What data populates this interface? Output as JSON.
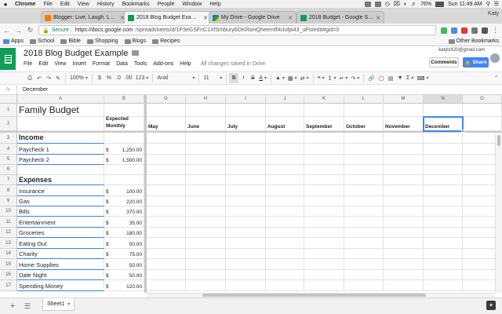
{
  "os_menubar": {
    "app": "Chrome",
    "items": [
      "File",
      "Edit",
      "View",
      "History",
      "Bookmarks",
      "People",
      "Window",
      "Help"
    ],
    "battery": "76%",
    "clock": "Sun 11:49 AM",
    "user": "Katy"
  },
  "browser_tabs": [
    {
      "title": "Blogger: Live. Laugh. Lowe.",
      "color": "#ff7a00"
    },
    {
      "title": "2018 Blog Budget Example - G",
      "color": "#0f9d58",
      "active": true
    },
    {
      "title": "My Drive - Google Drive",
      "color": "#1a73e8"
    },
    {
      "title": "2018 Budget - Google Sheets",
      "color": "#0f9d58"
    }
  ],
  "address_bar": {
    "secure_label": "Secure",
    "url_host": "https://docs.google.com",
    "url_path": "/spreadsheets/d/1P3eGSFnC1XfSmbury6OKRoHQheemff4clufpi43_uPo/edit#gid=0"
  },
  "bookmarks": {
    "items": [
      "Apps",
      "School",
      "Bible",
      "Shopping",
      "Blogs",
      "Recipes"
    ],
    "other": "Other Bookmarks"
  },
  "doc": {
    "title": "2018 Blog Budget Example",
    "menu": [
      "File",
      "Edit",
      "View",
      "Insert",
      "Format",
      "Data",
      "Tools",
      "Add-ons",
      "Help"
    ],
    "save_status": "All changes saved in Drive",
    "account": "katylz420@gmail.com",
    "comments_label": "Comments",
    "share_label": "Share"
  },
  "toolbar": {
    "zoom": "100%",
    "currency": "$",
    "percent": "%",
    "decimal_less": ".0",
    "decimal_more": ".00",
    "more_formats": "123",
    "font": "Arial",
    "font_size": "11",
    "bold": "B",
    "italic": "I",
    "strike": "S",
    "text_color": "A"
  },
  "formula_bar": {
    "fx": "fx",
    "value": "December"
  },
  "grid": {
    "columns": [
      "A",
      "B",
      "G",
      "H",
      "I",
      "J",
      "K",
      "L",
      "M",
      "N",
      "O"
    ],
    "rows": [
      "1",
      "2",
      "3",
      "4",
      "5",
      "6",
      "7",
      "8",
      "9",
      "10",
      "11",
      "12",
      "13",
      "14",
      "15",
      "16",
      "17"
    ],
    "title": "Family Budget",
    "expected_line1": "Expected",
    "expected_line2": "Monthly",
    "months": [
      "May",
      "June",
      "July",
      "August",
      "September",
      "October",
      "November",
      "December"
    ],
    "income_header": "Income",
    "expenses_header": "Expenses",
    "currency_symbol": "$",
    "income": [
      {
        "label": "Paycheck 1",
        "amount": "1,250.00"
      },
      {
        "label": "Paycheck 2",
        "amount": "1,500.00"
      }
    ],
    "expenses": [
      {
        "label": "Insurance",
        "amount": "100.00"
      },
      {
        "label": "Gas",
        "amount": "220.00"
      },
      {
        "label": "Bills",
        "amount": "370.00"
      },
      {
        "label": "Entertainment",
        "amount": "35.00"
      },
      {
        "label": "Groceries",
        "amount": "180.00"
      },
      {
        "label": "Eating Out",
        "amount": "50.00"
      },
      {
        "label": "Charity",
        "amount": "75.00"
      },
      {
        "label": "Home Supplies",
        "amount": "50.00"
      },
      {
        "label": "Date Night",
        "amount": "50.00"
      },
      {
        "label": "Spending Money",
        "amount": "120.00"
      }
    ]
  },
  "sheets": {
    "tabs": [
      "Sheet1"
    ]
  },
  "colors": {
    "accent": "#4285f4",
    "sheets_green": "#0f9d58",
    "section_underline": "#3f7fd6"
  }
}
